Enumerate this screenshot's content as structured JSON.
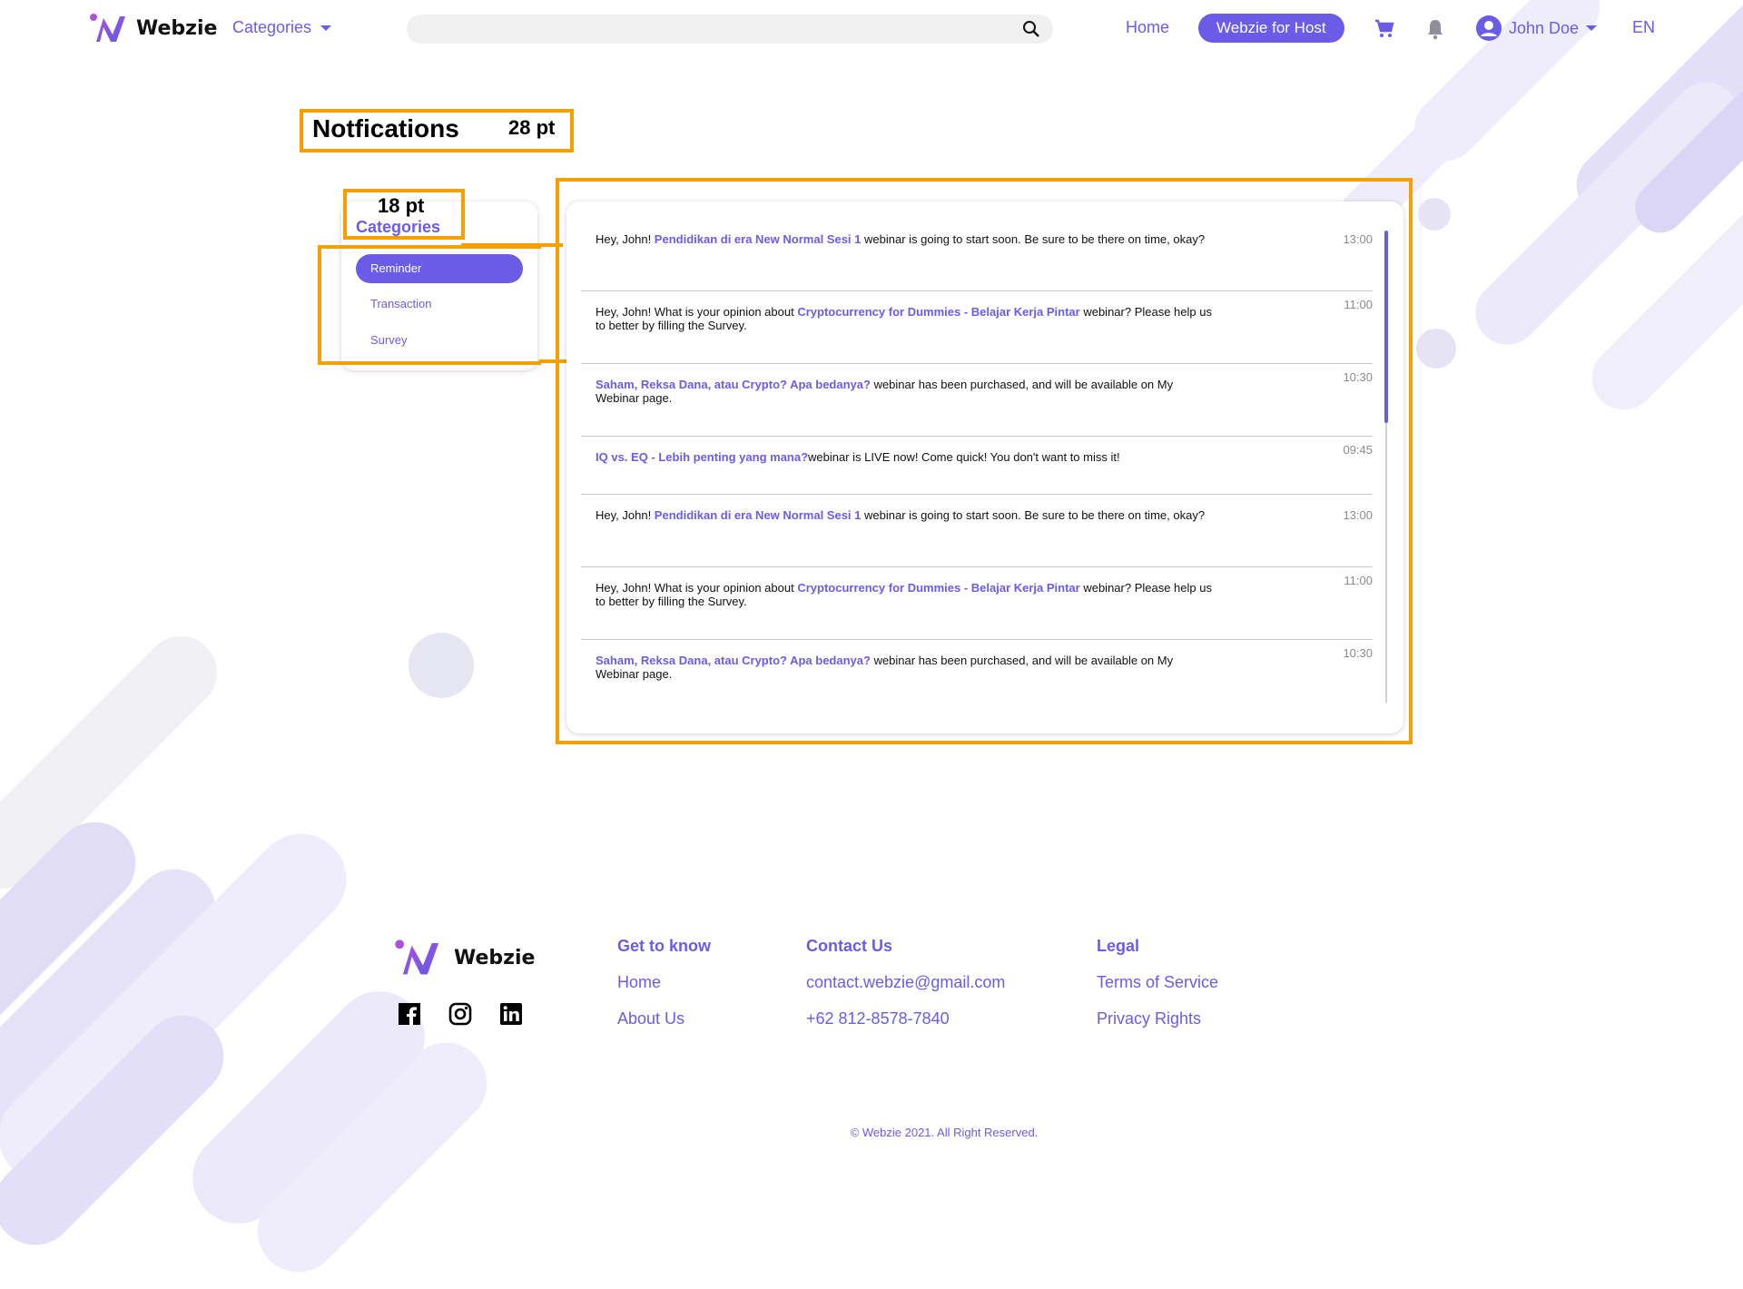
{
  "header": {
    "logo_text": "Webzie",
    "categories_label": "Categories",
    "search_placeholder": "",
    "home_label": "Home",
    "host_button": "Webzie for Host",
    "user_name": "John Doe",
    "language": "EN"
  },
  "page": {
    "title": "Notfications",
    "title_size_note": "28 pt",
    "categories_size_note": "18 pt"
  },
  "sidebar": {
    "title": "Categories",
    "items": [
      {
        "label": "Reminder",
        "active": true
      },
      {
        "label": "Transaction",
        "active": false
      },
      {
        "label": "Survey",
        "active": false
      }
    ]
  },
  "notifications": [
    {
      "pre": "Hey, John! ",
      "highlight": "Pendidikan di era New Normal Sesi 1",
      "post": " webinar is going to start soon. Be sure to be there on time, okay?",
      "time": "13:00"
    },
    {
      "pre": "Hey, John! What is your opinion about ",
      "highlight": "Cryptocurrency for Dummies - Belajar Kerja Pintar",
      "post": " webinar? Please help us to better by filling the Survey.",
      "time": "11:00"
    },
    {
      "pre": "",
      "highlight": "Saham, Reksa Dana, atau Crypto? Apa bedanya?",
      "post": " webinar has been purchased, and will be available on My Webinar page.",
      "time": "10:30"
    },
    {
      "pre": "",
      "highlight": "IQ vs. EQ - Lebih penting yang mana?",
      "post": "webinar is LIVE now! Come quick! You don't want to miss it!",
      "time": "09:45"
    },
    {
      "pre": "Hey, John! ",
      "highlight": "Pendidikan di era New Normal Sesi 1",
      "post": " webinar is going to start soon. Be sure to be there on time, okay?",
      "time": "13:00"
    },
    {
      "pre": "Hey, John! What is your opinion about ",
      "highlight": "Cryptocurrency for Dummies - Belajar Kerja Pintar",
      "post": " webinar? Please help us to better by filling the Survey.",
      "time": "11:00"
    },
    {
      "pre": "",
      "highlight": "Saham, Reksa Dana, atau Crypto? Apa bedanya?",
      "post": " webinar has been purchased, and will be available on My Webinar page.",
      "time": "10:30"
    }
  ],
  "footer": {
    "logo_text": "Webzie",
    "social_icons": [
      "facebook-icon",
      "instagram-icon",
      "linkedin-icon"
    ],
    "columns": [
      {
        "heading": "Get to know",
        "links": [
          "Home",
          "About Us"
        ]
      },
      {
        "heading": "Contact Us",
        "links": [
          "contact.webzie@gmail.com",
          "+62 812-8578-7840"
        ]
      },
      {
        "heading": "Legal",
        "links": [
          "Terms of Service",
          "Privacy Rights"
        ]
      }
    ],
    "copyright": "© Webzie 2021. All Right Reserved."
  },
  "colors": {
    "accent": "#6b5ce7",
    "annotation": "#f5a000"
  }
}
